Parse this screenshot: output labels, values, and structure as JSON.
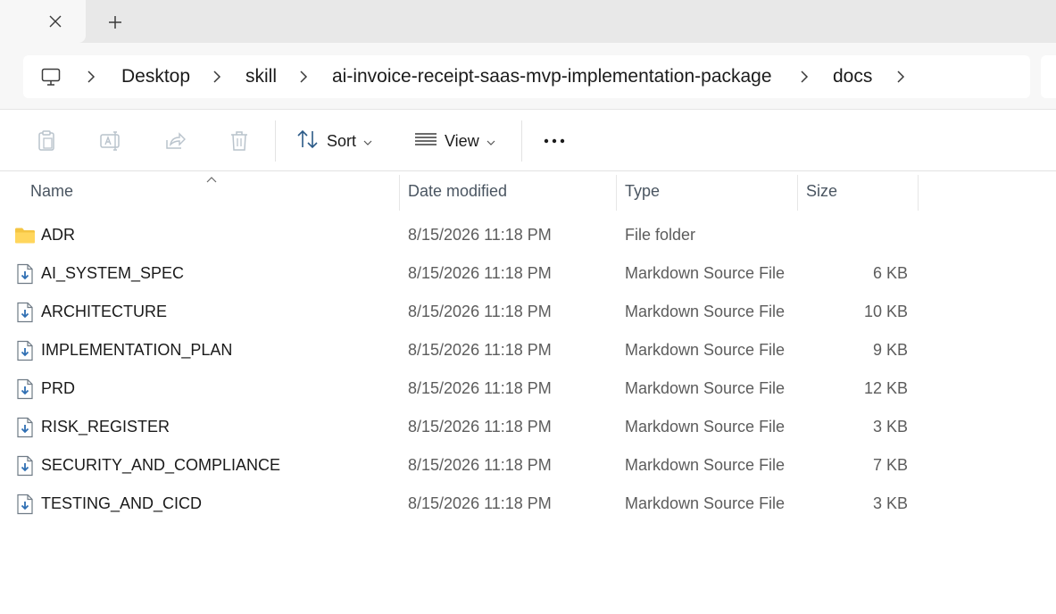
{
  "tabstrip": {
    "close_icon": "close-icon",
    "new_tab_icon": "plus-icon"
  },
  "address": {
    "root_icon": "this-pc-icon",
    "crumbs": [
      {
        "label": "Desktop"
      },
      {
        "label": "skill"
      },
      {
        "label": "ai-invoice-receipt-saas-mvp-implementation-package"
      },
      {
        "label": "docs"
      }
    ]
  },
  "toolbar": {
    "icons": [
      "paste-icon",
      "rename-icon",
      "share-icon",
      "delete-icon"
    ],
    "sort_label": "Sort",
    "view_label": "View",
    "more_icon": "more-icon"
  },
  "columns": {
    "name": "Name",
    "date": "Date modified",
    "type": "Type",
    "size": "Size"
  },
  "files": [
    {
      "name": "ADR",
      "date": "8/15/2026 11:18 PM",
      "type": "File folder",
      "size": "",
      "icon": "folder-icon"
    },
    {
      "name": "AI_SYSTEM_SPEC",
      "date": "8/15/2026 11:18 PM",
      "type": "Markdown Source File",
      "size": "6 KB",
      "icon": "markdown-file-icon"
    },
    {
      "name": "ARCHITECTURE",
      "date": "8/15/2026 11:18 PM",
      "type": "Markdown Source File",
      "size": "10 KB",
      "icon": "markdown-file-icon"
    },
    {
      "name": "IMPLEMENTATION_PLAN",
      "date": "8/15/2026 11:18 PM",
      "type": "Markdown Source File",
      "size": "9 KB",
      "icon": "markdown-file-icon"
    },
    {
      "name": "PRD",
      "date": "8/15/2026 11:18 PM",
      "type": "Markdown Source File",
      "size": "12 KB",
      "icon": "markdown-file-icon"
    },
    {
      "name": "RISK_REGISTER",
      "date": "8/15/2026 11:18 PM",
      "type": "Markdown Source File",
      "size": "3 KB",
      "icon": "markdown-file-icon"
    },
    {
      "name": "SECURITY_AND_COMPLIANCE",
      "date": "8/15/2026 11:18 PM",
      "type": "Markdown Source File",
      "size": "7 KB",
      "icon": "markdown-file-icon"
    },
    {
      "name": "TESTING_AND_CICD",
      "date": "8/15/2026 11:18 PM",
      "type": "Markdown Source File",
      "size": "3 KB",
      "icon": "markdown-file-icon"
    }
  ]
}
